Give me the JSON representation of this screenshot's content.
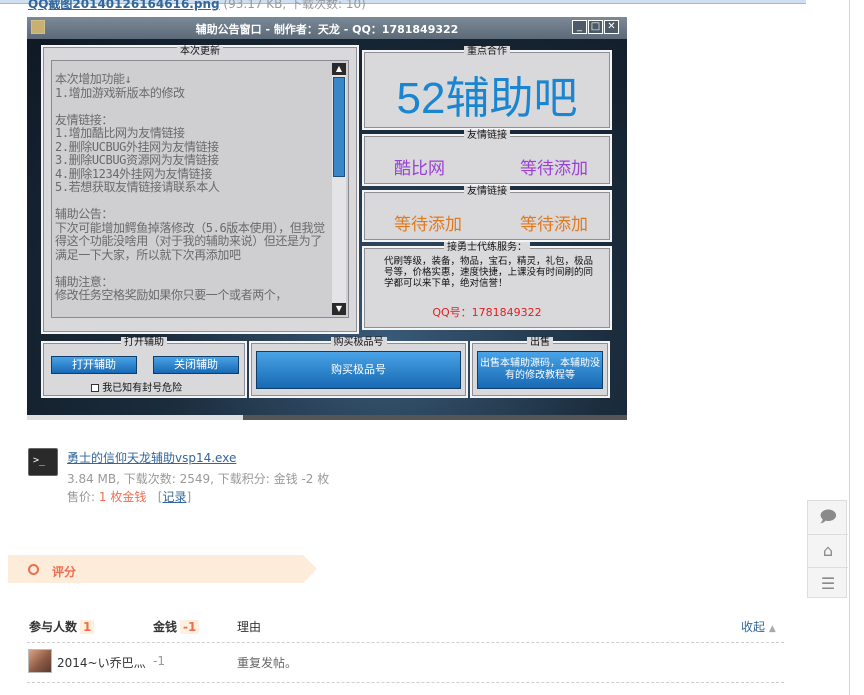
{
  "post": {
    "image_filename": "QQ截图20140126164616.png",
    "image_meta": "(93.17 KB, 下载次数: 10)"
  },
  "app": {
    "window_title": "辅助公告窗口 - 制作者：天龙 - QQ：1781849322",
    "window_buttons": [
      "_",
      "□",
      "✕"
    ],
    "update_panel": {
      "legend": "本次更新",
      "text": "本次增加功能↓\n1.增加游戏新版本的修改\n\n友情链接：\n1.增加酷比网为友情链接\n2.删除UCBUG外挂网为友情链接\n3.删除UCBUG资源网为友情链接\n4.删除1234外挂网为友情链接\n5.若想获取友情链接请联系本人\n\n辅助公告：\n下次可能增加鳄鱼掉落修改（5.6版本使用），但我觉得这个功能没啥用（对于我的辅助来说）但还是为了满足一下大家，所以就下次再添加吧\n\n辅助注意：\n修改任务空格奖励如果你只要一个或者两个，"
    },
    "partner_panel": {
      "legend": "重点合作",
      "name": "52辅助吧"
    },
    "friend_links_1": {
      "legend": "友情链接",
      "left": "酷比网",
      "right": "等待添加"
    },
    "friend_links_2": {
      "legend": "友情链接",
      "left": "等待添加",
      "right": "等待添加"
    },
    "training_panel": {
      "legend": "接勇士代练服务：",
      "text": "代刷等级，装备，物品，宝石，精灵，礼包，极品号等，价格实惠，速度快捷，上课没有时间刷的同学都可以来下单，绝对信誉！",
      "qq": "QQ号：1781849322"
    },
    "helper_panel": {
      "legend": "打开辅助",
      "open_label": "打开辅助",
      "close_label": "关闭辅助",
      "risk_label": "我已知有封号危险"
    },
    "buy_panel": {
      "legend": "购买极品号",
      "button_label": "购买极品号"
    },
    "sale_panel": {
      "legend": "出售",
      "button_label": "出售本辅助源码，本辅助没有的修改教程等"
    },
    "progress": 0.36
  },
  "attachment": {
    "filename": "勇士的信仰天龙辅助vsp14.exe",
    "meta": "3.84 MB, 下载次数: 2549, 下载积分: 金钱 -2 枚",
    "price_label": "售价:",
    "price_value": "1 枚金钱",
    "record_label": "记录"
  },
  "rating": {
    "section_title": "评分",
    "col_participants": "参与人数",
    "participants_count": "1",
    "col_money": "金钱",
    "money_total": "-1",
    "col_reason": "理由",
    "collapse_label": "收起",
    "rows": [
      {
        "user": "2014~い乔巴灬",
        "money": "-1",
        "reason": "重复发帖。"
      }
    ]
  },
  "side_tools": [
    "comment-icon",
    "back-to-top-icon",
    "list-icon"
  ]
}
